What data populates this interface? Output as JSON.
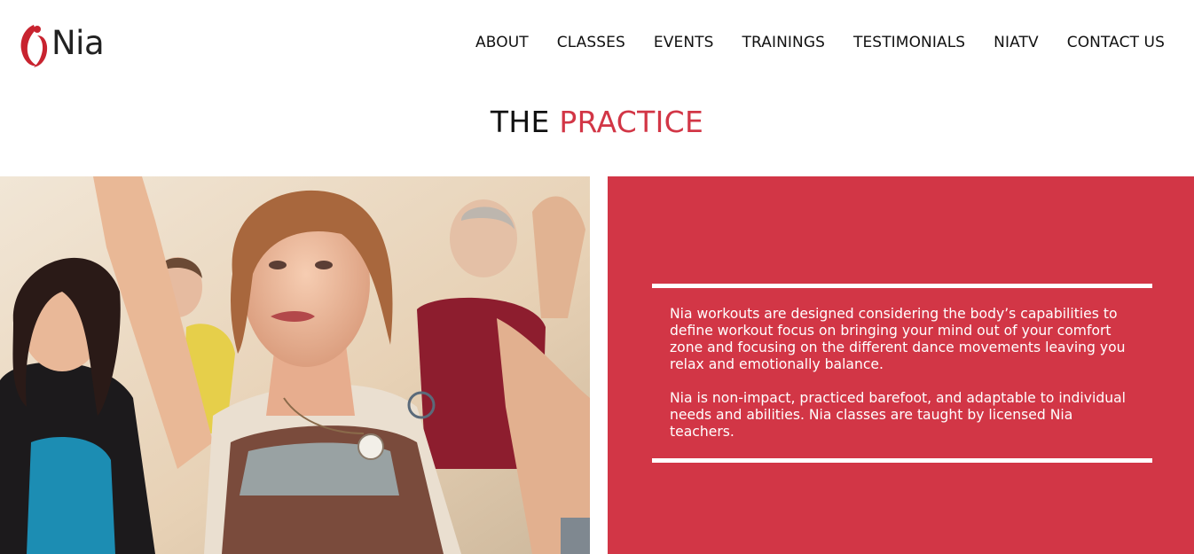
{
  "brand": {
    "logo_text": "Nia",
    "accent_color": "#d23646"
  },
  "nav": {
    "items": [
      {
        "label": "ABOUT"
      },
      {
        "label": "CLASSES"
      },
      {
        "label": "EVENTS"
      },
      {
        "label": "TRAININGS"
      },
      {
        "label": "TESTIMONIALS"
      },
      {
        "label": "NIATV"
      },
      {
        "label": "CONTACT US"
      }
    ]
  },
  "section": {
    "title_prefix": "THE ",
    "title_accent": "PRACTICE"
  },
  "panel": {
    "paragraphs": [
      "Nia workouts are designed considering the body’s capabilities to define workout focus on bringing your mind out of your comfort zone and focusing on the different dance movements leaving you relax and emotionally balance.",
      "Nia is non-impact, practiced barefoot, and adaptable to individual needs and abilities. Nia classes are taught by licensed Nia teachers."
    ]
  },
  "photo": {
    "icon": "dance-class-photo"
  }
}
